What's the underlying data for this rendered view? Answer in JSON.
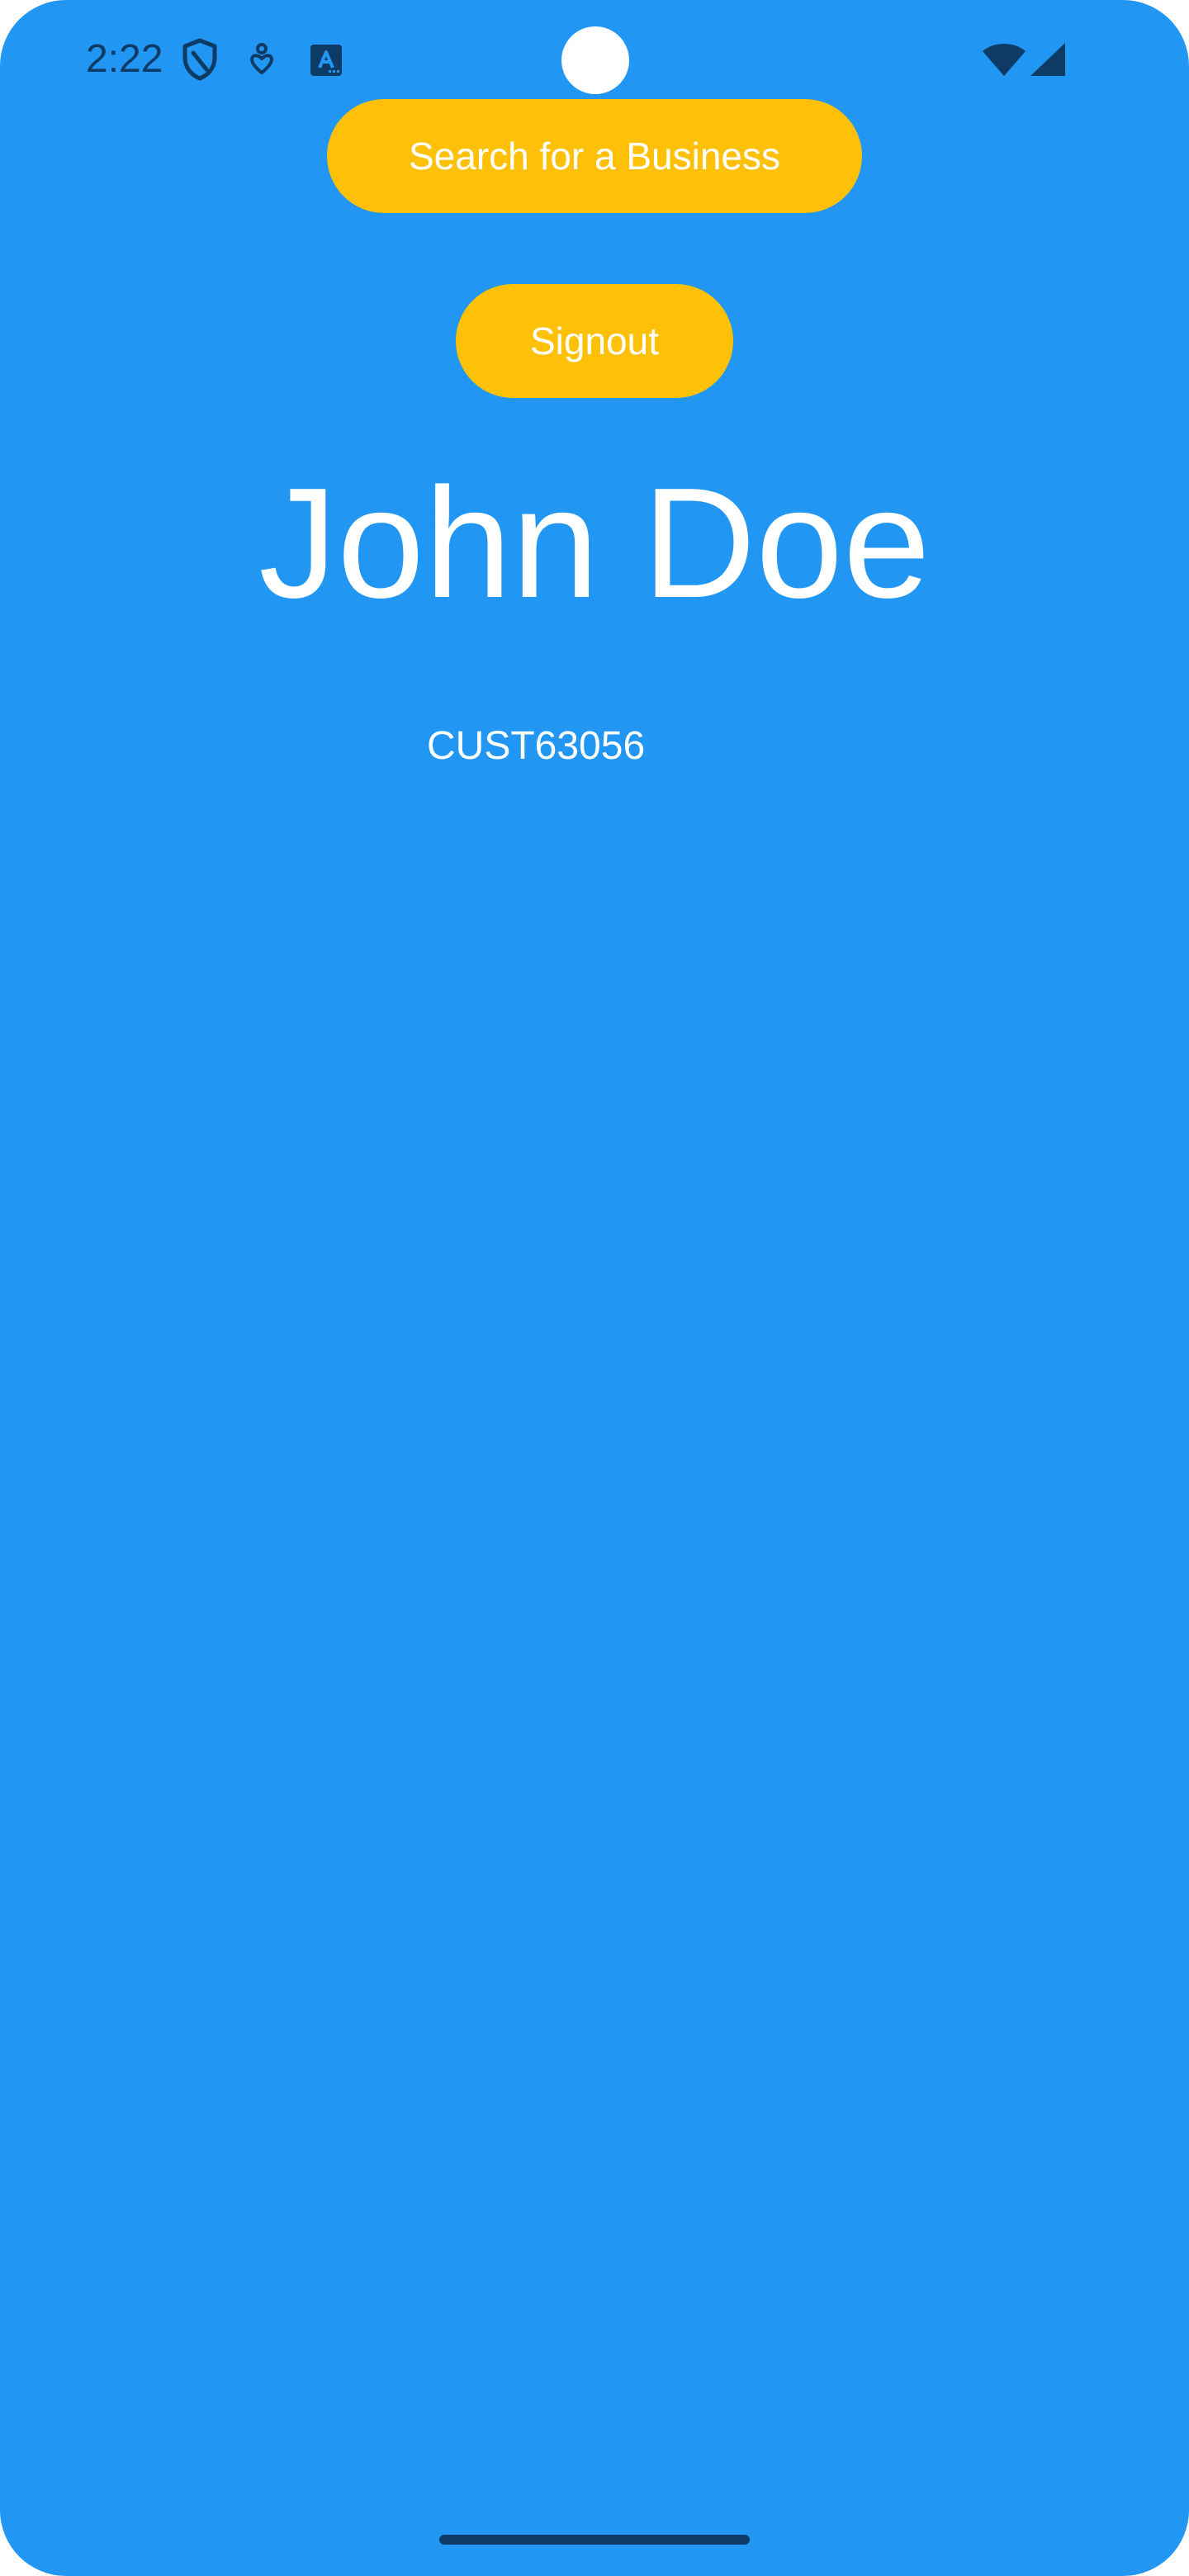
{
  "status_bar": {
    "time": "2:22",
    "icons": [
      "shield-icon",
      "health-icon",
      "translate-icon",
      "wifi-icon",
      "signal-icon"
    ],
    "icon_color": "#0d3b66"
  },
  "actions": {
    "search_label": "Search for a Business",
    "signout_label": "Signout"
  },
  "profile": {
    "name": "John Doe",
    "customer_id": "CUST63056"
  },
  "colors": {
    "background": "#2196F3",
    "button": "#FFC107",
    "text": "#ffffff"
  }
}
